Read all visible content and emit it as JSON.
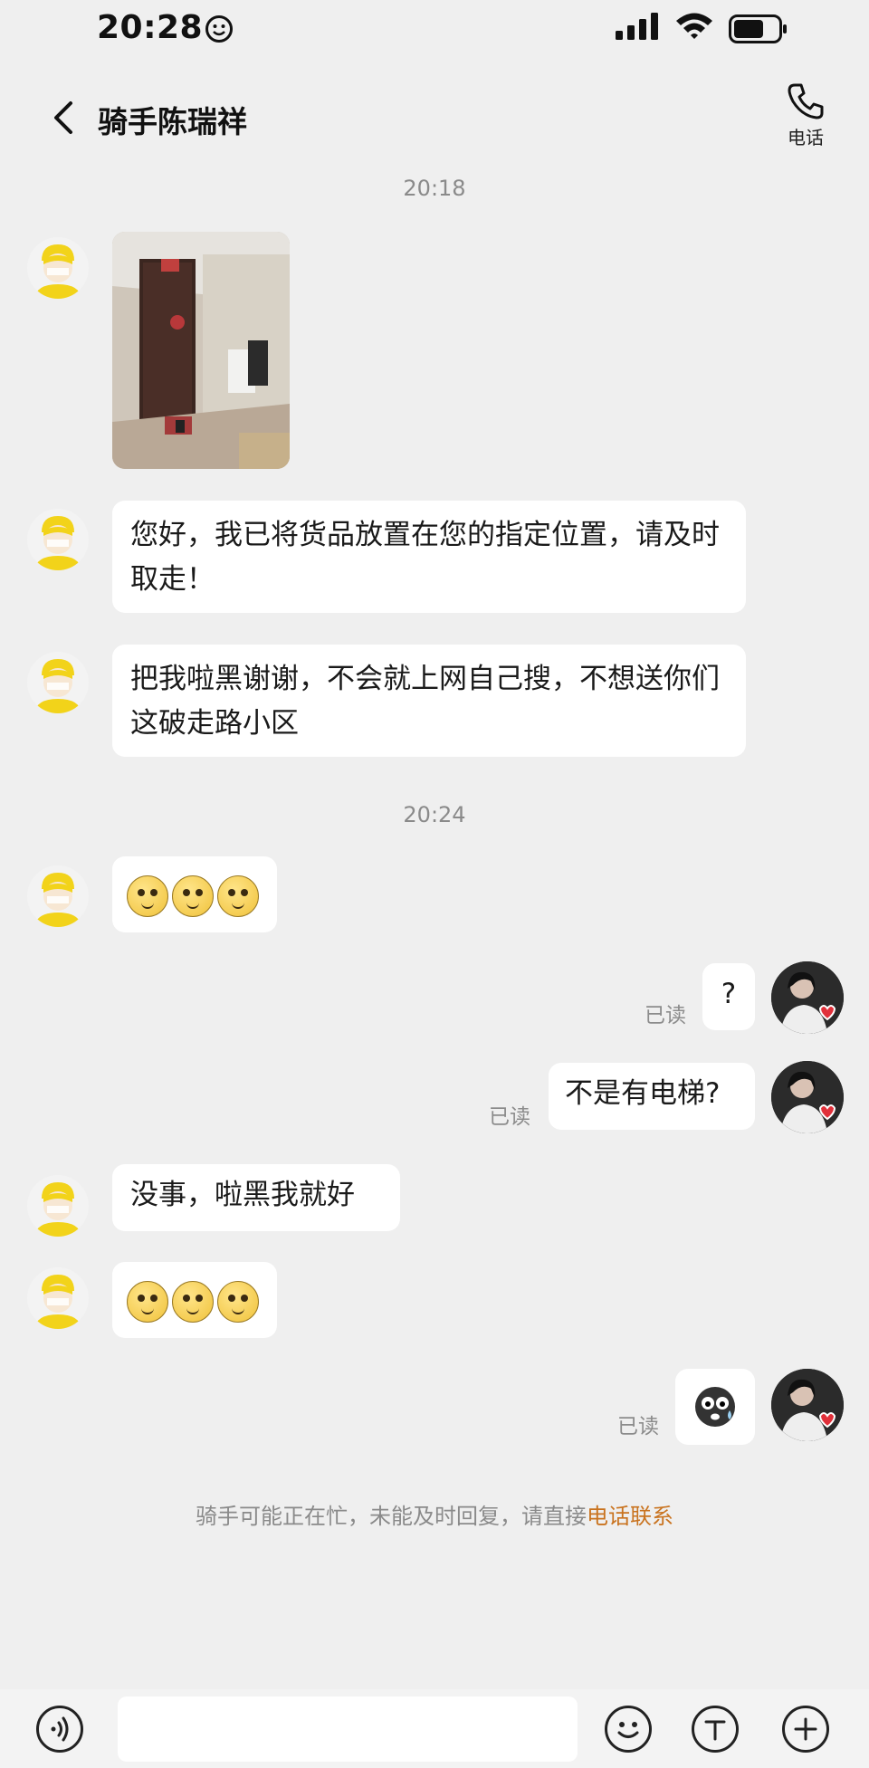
{
  "status_bar": {
    "time": "20:28"
  },
  "nav": {
    "title": "骑手陈瑞祥",
    "call_label": "电话"
  },
  "timestamps": [
    "20:18",
    "20:24"
  ],
  "messages": {
    "rider_1": "您好，我已将货品放置在您的指定位置，请及时取走！",
    "rider_2": "把我啦黑谢谢，不会就上网自己搜，不想送你们这破走路小区",
    "rider_3": "没事，啦黑我就好",
    "me_1": "?",
    "me_2": "不是有电梯?"
  },
  "read_label": "已读",
  "notice": {
    "text": "骑手可能正在忙，未能及时回复，请直接",
    "link": "电话联系"
  },
  "colors": {
    "background": "#efefef",
    "link": "#c9731f",
    "bubble": "#ffffff"
  }
}
